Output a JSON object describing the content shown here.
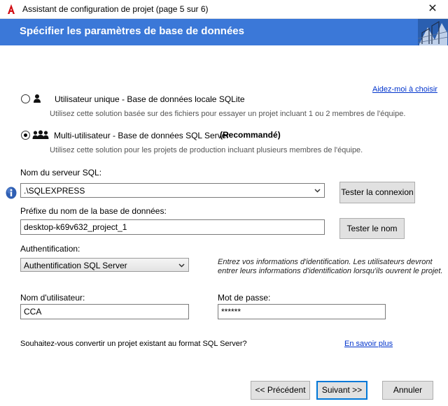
{
  "window": {
    "title": "Assistant de configuration de projet (page 5 sur 6)",
    "close_glyph": "✕"
  },
  "banner": {
    "title": "Spécifier les paramètres de base de données",
    "accent": "#3b78d8"
  },
  "help_link": "Aidez-moi à choisir",
  "options": [
    {
      "label": "Utilisateur unique - Base de données locale SQLite",
      "description": "Utilisez cette solution basée sur des fichiers pour essayer un projet incluant 1 ou 2 membres de l'équipe.",
      "selected": false,
      "icon": "single-user-icon"
    },
    {
      "label": "Multi-utilisateur - Base de données SQL Server",
      "badge": "(Recommandé)",
      "description": "Utilisez cette solution pour les projets de production incluant plusieurs membres de l'équipe.",
      "selected": true,
      "icon": "multi-user-icon"
    }
  ],
  "server": {
    "label": "Nom du serveur SQL:",
    "value": ".\\SQLEXPRESS",
    "test_button": "Tester la connexion"
  },
  "db_prefix": {
    "label": "Préfixe du nom de la base de données:",
    "value": "desktop-k69v632_project_1",
    "test_button": "Tester le nom"
  },
  "auth": {
    "label": "Authentification:",
    "value": "Authentification SQL Server",
    "note_line1": "Entrez vos informations d'identification. Les utilisateurs devront",
    "note_line2": "entrer leurs informations d'identification lorsqu'ils ouvrent le projet."
  },
  "username": {
    "label": "Nom d'utilisateur:",
    "value": "CCA"
  },
  "password": {
    "label": "Mot de passe:",
    "value": "******"
  },
  "convert": {
    "question": "Souhaitez-vous convertir un projet existant au format SQL Server?",
    "link": "En savoir plus"
  },
  "footer": {
    "back": "<< Précédent",
    "next": "Suivant >>",
    "cancel": "Annuler"
  }
}
